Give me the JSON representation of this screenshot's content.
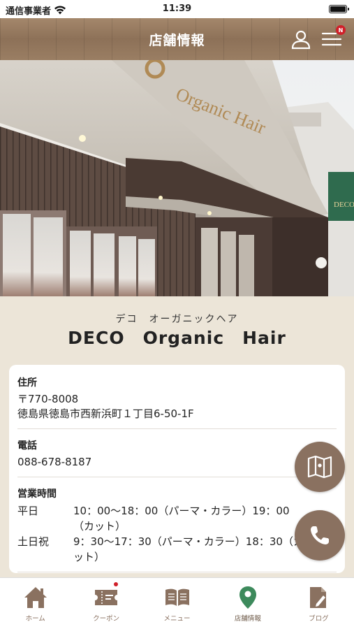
{
  "status_bar": {
    "carrier": "通信事業者",
    "time": "11:39"
  },
  "header": {
    "title": "店舗情報",
    "menu_badge": "N"
  },
  "shop": {
    "name_kana": "デコ　オーガニックヘア",
    "name": "DECO　Organic　Hair"
  },
  "hero_sign": {
    "text": "Organic Hair",
    "side_text": "DECO"
  },
  "info": {
    "address": {
      "label": "住所",
      "postal": "〒770-8008",
      "line": "徳島県徳島市西新浜町１丁目6-50-1F"
    },
    "phone": {
      "label": "電話",
      "number": "088-678-8187"
    },
    "hours": {
      "label": "営業時間",
      "rows": [
        {
          "day": "平日",
          "time": "10：00〜18：00（パーマ・カラー）19：00（カット）"
        },
        {
          "day": "土日祝",
          "time": "9：30〜17：30（パーマ・カラー）18：30（カット）"
        }
      ]
    }
  },
  "tabs": [
    {
      "label": "ホーム",
      "icon": "home-icon"
    },
    {
      "label": "クーポン",
      "icon": "coupon-icon"
    },
    {
      "label": "メニュー",
      "icon": "book-icon"
    },
    {
      "label": "店舗情報",
      "icon": "map-pin-icon"
    },
    {
      "label": "ブログ",
      "icon": "document-edit-icon"
    }
  ],
  "colors": {
    "accent": "#8a7160",
    "active_tab": "#3d8a5c",
    "background": "#ece5d8",
    "badge": "#d0202a"
  }
}
